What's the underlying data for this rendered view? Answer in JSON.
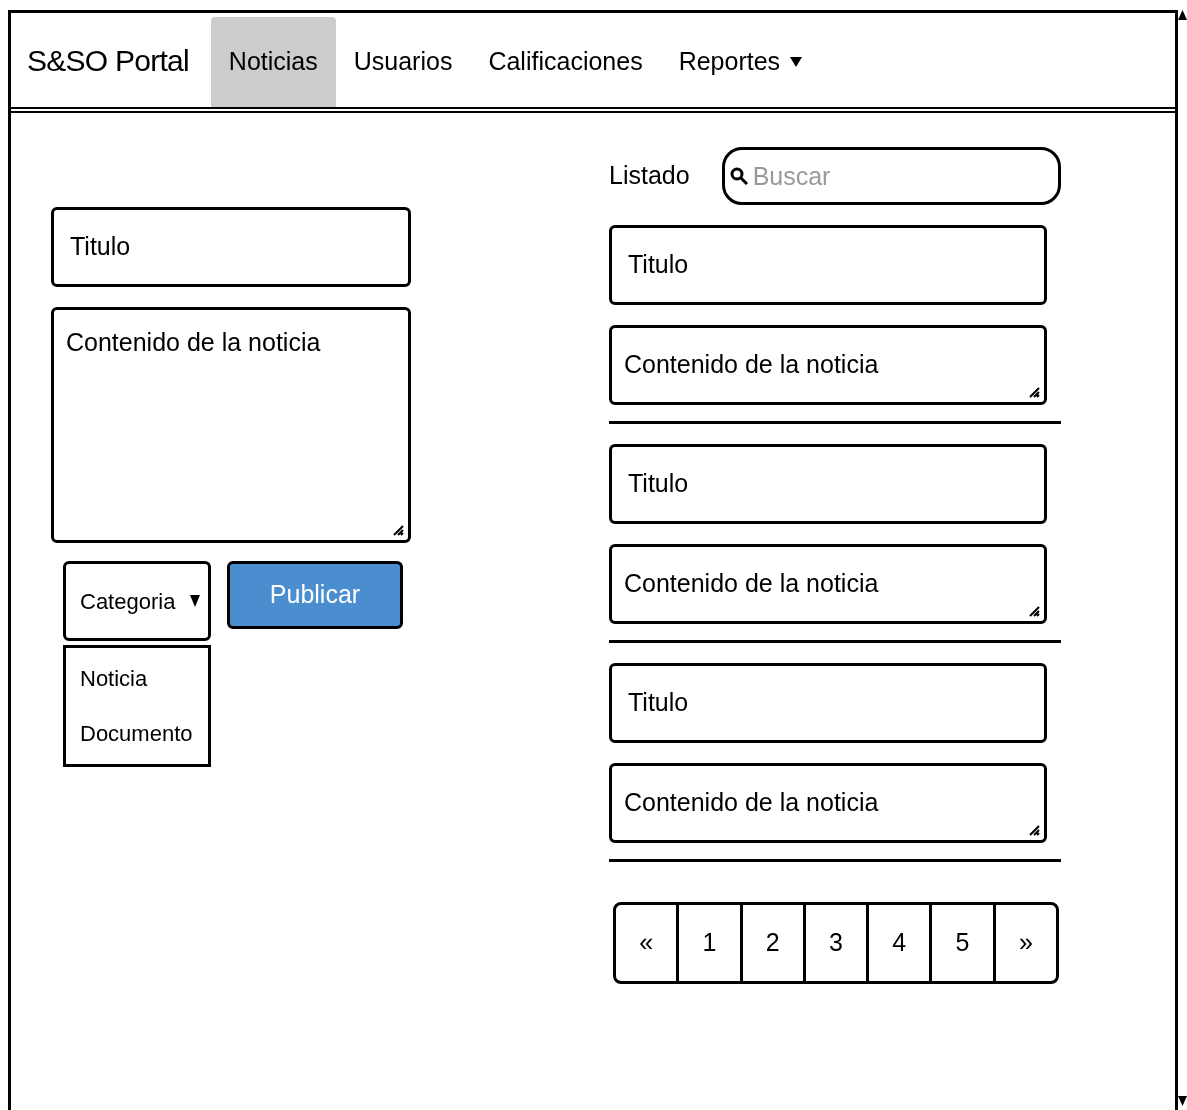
{
  "nav": {
    "brand": "S&SO Portal",
    "items": [
      {
        "label": "Noticias",
        "selected": true,
        "dropdown": false
      },
      {
        "label": "Usuarios",
        "selected": false,
        "dropdown": false
      },
      {
        "label": "Calificaciones",
        "selected": false,
        "dropdown": false
      },
      {
        "label": "Reportes",
        "selected": false,
        "dropdown": true
      }
    ]
  },
  "form": {
    "title_field": {
      "value": "Titulo"
    },
    "content_field": {
      "value": "Contenido de la noticia"
    },
    "category_select": {
      "value": "Categoria",
      "expanded": true,
      "options": [
        "Noticia",
        "Documento"
      ]
    },
    "publish_button": "Publicar"
  },
  "list": {
    "label": "Listado",
    "search": {
      "placeholder": "Buscar"
    },
    "entries": [
      {
        "title": "Titulo",
        "content": "Contenido de la noticia"
      },
      {
        "title": "Titulo",
        "content": "Contenido de la noticia"
      },
      {
        "title": "Titulo",
        "content": "Contenido de la noticia"
      }
    ],
    "pagination": [
      "«",
      "1",
      "2",
      "3",
      "4",
      "5",
      "»"
    ]
  }
}
